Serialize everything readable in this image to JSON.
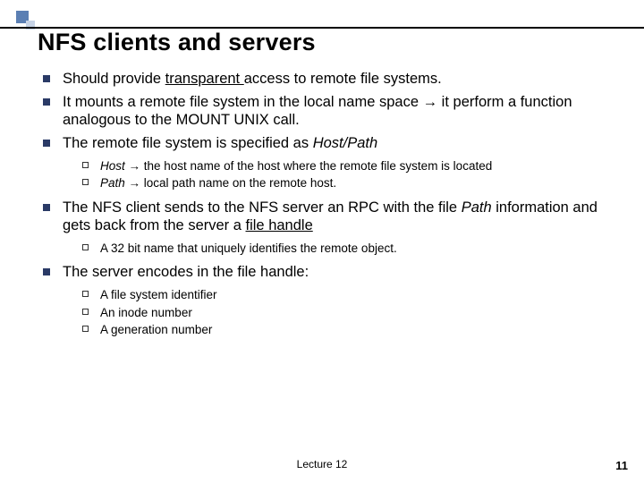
{
  "title": "NFS clients and servers",
  "bullets": {
    "b0": {
      "pre": "Should provide ",
      "u": "transparent ",
      "post": "access to remote file systems."
    },
    "b1": "It mounts a remote file system in the local name space → it perform a function analogous to the MOUNT UNIX call.",
    "b2": {
      "pre": "The remote file system is specified as ",
      "it": "Host/Path"
    },
    "b2sub": {
      "s0": {
        "it": "Host",
        "rest": " → the host name of the host where the remote file system is located"
      },
      "s1": {
        "it": "Path ",
        "rest": " → local path name on the remote host."
      }
    },
    "b3": {
      "p0": "The NFS client sends to the NFS server an RPC with the file ",
      "it": "Path",
      "p1": " information  and gets back from the server a ",
      "u": "file handle"
    },
    "b3sub": {
      "s0": "A 32 bit name that uniquely identifies the remote object."
    },
    "b4": "The server encodes in the file handle:",
    "b4sub": {
      "s0": "A file system identifier",
      "s1": "An inode number",
      "s2": "A generation number"
    }
  },
  "footer": {
    "center": "Lecture 12",
    "right": "11"
  }
}
